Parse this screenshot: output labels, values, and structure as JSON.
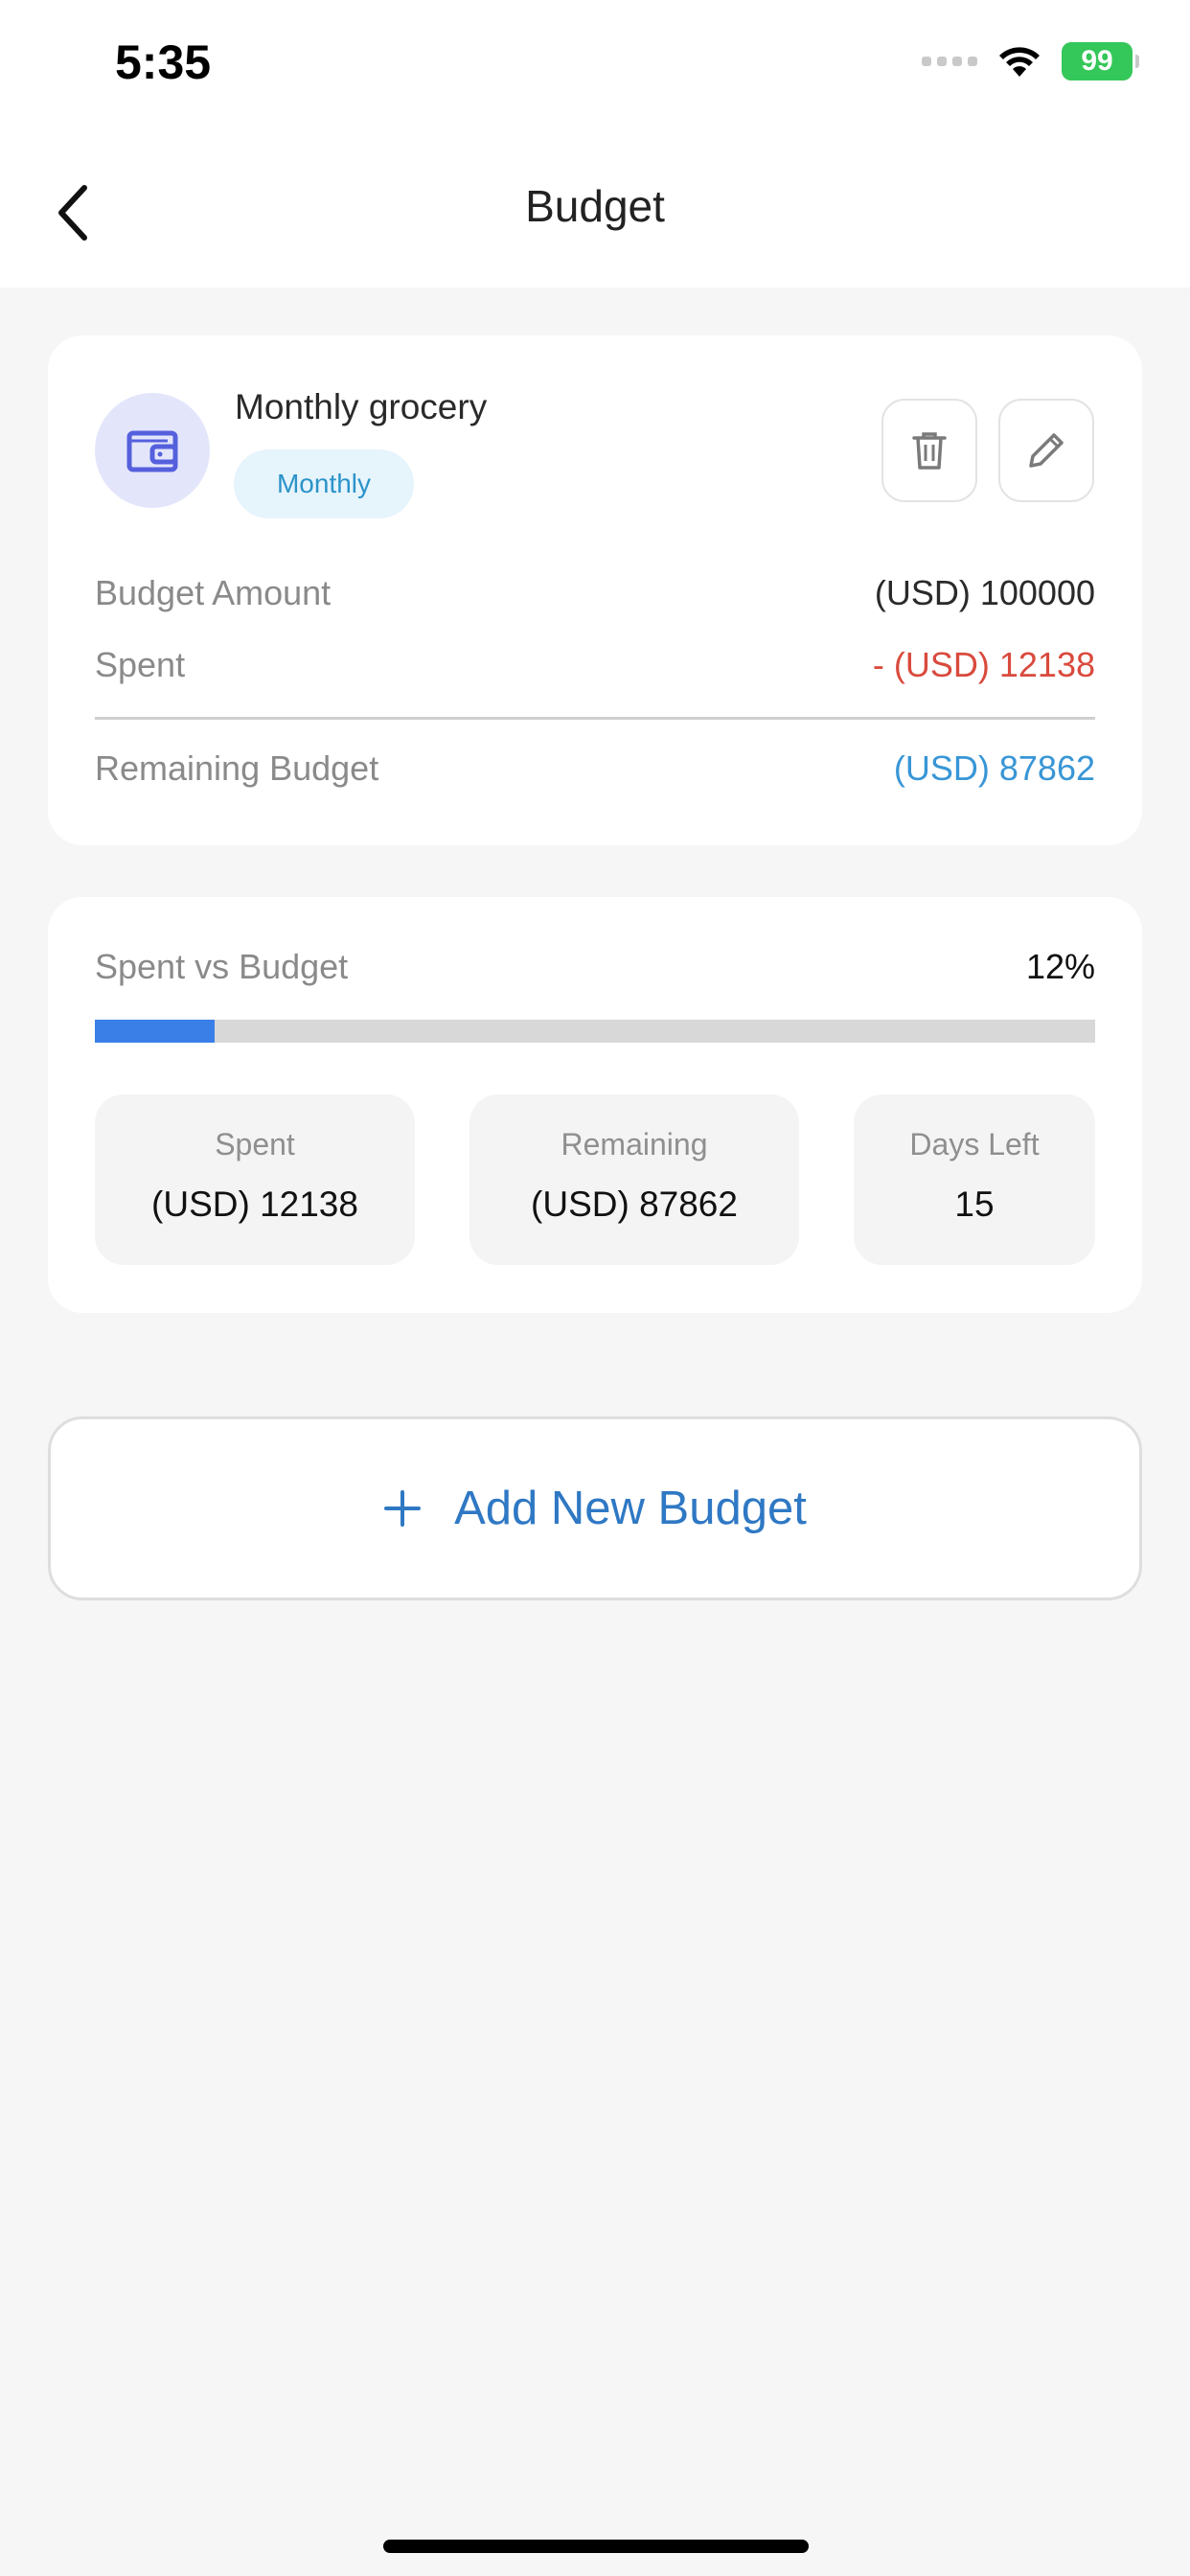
{
  "status_bar": {
    "time": "5:35",
    "battery": "99",
    "icons": [
      "signal-icon",
      "wifi-icon",
      "battery-icon"
    ]
  },
  "header": {
    "title": "Budget",
    "back_icon": "chevron-left-icon"
  },
  "budget_card": {
    "icon": "wallet-icon",
    "name": "Monthly grocery",
    "period": "Monthly",
    "actions": [
      "trash-icon",
      "pencil-icon"
    ],
    "rows": {
      "amount": {
        "label": "Budget Amount",
        "value": "(USD) 100000"
      },
      "spent": {
        "label": "Spent",
        "value": "- (USD) 12138"
      },
      "remaining": {
        "label": "Remaining Budget",
        "value": "(USD) 87862"
      }
    }
  },
  "progress_card": {
    "label": "Spent vs Budget",
    "percent_text": "12%",
    "fill_percent": 12,
    "stats": {
      "spent": {
        "label": "Spent",
        "value": "(USD) 12138"
      },
      "remaining": {
        "label": "Remaining",
        "value": "(USD) 87862"
      },
      "days_left": {
        "label": "Days Left",
        "value": "15"
      }
    }
  },
  "add_button": {
    "label": "Add New Budget",
    "icon": "plus-icon"
  },
  "colors": {
    "accent": "#2f78c4",
    "progress": "#3a7fe8",
    "negative": "#d94a3d",
    "remaining": "#3896d6",
    "battery": "#34c759"
  }
}
